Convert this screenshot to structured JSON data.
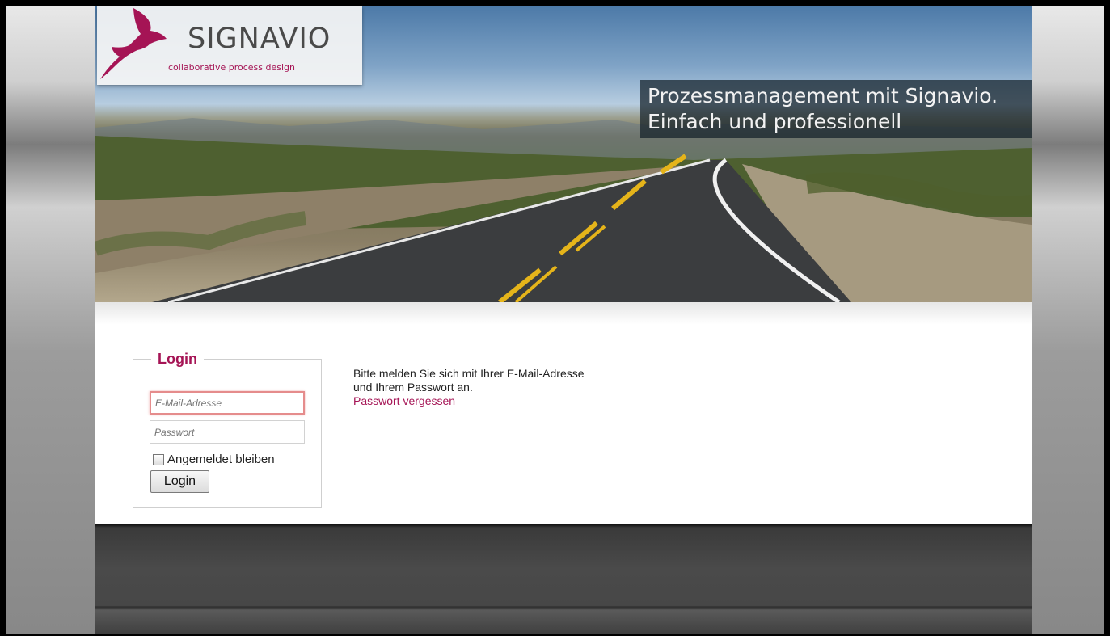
{
  "brand": {
    "name": "SIGNAVIO",
    "tagline": "collaborative process design",
    "color": "#a51455"
  },
  "banner": {
    "line1": "Prozessmanagement mit Signavio.",
    "line2": "Einfach und professionell"
  },
  "login": {
    "legend": "Login",
    "email_placeholder": "E-Mail-Adresse",
    "password_placeholder": "Passwort",
    "remember_label": "Angemeldet bleiben",
    "remember_checked": false,
    "button_label": "Login"
  },
  "info": {
    "text": "Bitte melden Sie sich mit Ihrer E-Mail-Adresse und Ihrem Passwort an.",
    "forgot_link": "Passwort vergessen"
  }
}
